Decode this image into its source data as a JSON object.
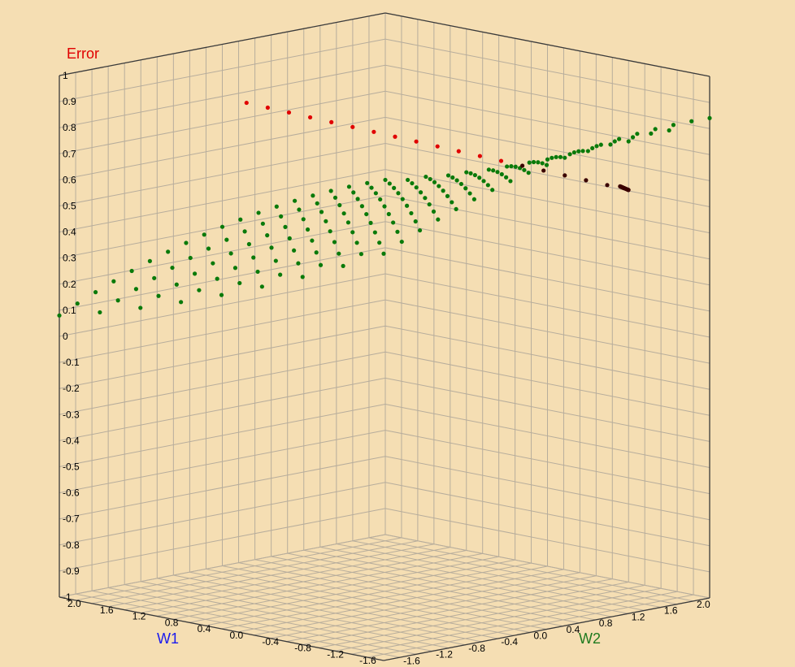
{
  "chart_data": {
    "type": "scatter",
    "projection": "3d",
    "axes": {
      "z_label": "Error",
      "x_label": "W1",
      "y_label": "W2",
      "z_range": [
        -1,
        1
      ],
      "x_range": [
        -2.0,
        2.0
      ],
      "y_range": [
        -2.0,
        2.0
      ],
      "z_ticks": [
        "1",
        "0.9",
        "0.8",
        "0.7",
        "0.6",
        "0.5",
        "0.4",
        "0.3",
        "0.2",
        "0.1",
        "0",
        "-0.1",
        "-0.2",
        "-0.3",
        "-0.4",
        "-0.5",
        "-0.6",
        "-0.7",
        "-0.8",
        "-0.9",
        "-1"
      ],
      "w1_ticks": [
        "2.0",
        "1.6",
        "1.2",
        "0.8",
        "0.4",
        "0.0",
        "-0.4",
        "-0.8",
        "-1.2",
        "-1.6"
      ],
      "w2_ticks": [
        "-1.6",
        "-1.2",
        "-0.8",
        "-0.4",
        "0.0",
        "0.4",
        "0.8",
        "1.2",
        "1.6",
        "2.0"
      ]
    },
    "grid": true,
    "colors": {
      "background": "#f5deb3",
      "z_label": "#e00000",
      "x_label": "#1a1aee",
      "y_label": "#1f7a1f",
      "surface_points": "#0a7a0a",
      "path_early": "#e00000",
      "path_late": "#3a0000"
    },
    "series": [
      {
        "kind": "surface",
        "description_values": "Error surface: error = 0.5 + 0.2*(W1 + W2)/2 approximately, sampled on a grid",
        "w1_range": [
          -2.0,
          2.0
        ],
        "w2_range": [
          -2.0,
          2.0
        ],
        "w1_steps": 19,
        "w2_steps": 9
      },
      {
        "kind": "path",
        "segments": [
          {
            "w1": [
              0.3,
              -1.7
            ],
            "w2": [
              -1.4,
              1.3
            ],
            "error": [
              0.83,
              0.54
            ]
          },
          {
            "w1": [
              -1.7,
              -1.1
            ],
            "w2": [
              1.3,
              1.8
            ],
            "error": [
              0.54,
              0.62
            ]
          }
        ]
      }
    ]
  }
}
